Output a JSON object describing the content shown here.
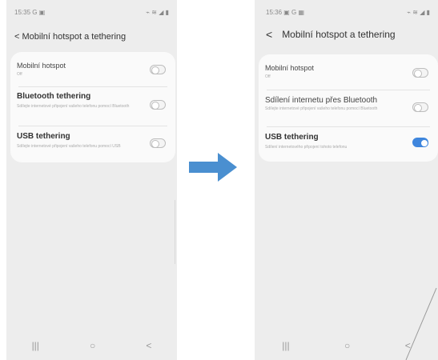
{
  "left": {
    "status_time": "15:35",
    "status_left_icons": "G ▣",
    "status_right_icons": "⌁ ≋ ◢ ▮",
    "title": "< Mobilní hotspot a tethering",
    "rows": [
      {
        "title": "Mobilní hotspot",
        "subtitle": "Off",
        "toggle": "off"
      },
      {
        "title": "Bluetooth tethering",
        "subtitle": "Sdílejte internetové připojení vašeho telefonu pomocí Bluetooth",
        "toggle": "off"
      },
      {
        "title": "USB tethering",
        "subtitle": "Sdílejte internetové připojení vašeho telefonu pomocí USB",
        "toggle": "off"
      }
    ],
    "nav": {
      "recent": "|||",
      "home": "○",
      "back": "<"
    }
  },
  "right": {
    "status_time": "15:36",
    "status_left_icons": "▣ G ▦",
    "status_right_icons": "⌁ ≋ ◢ ▮",
    "back_glyph": "<",
    "title": "Mobilní hotspot a tethering",
    "rows": [
      {
        "title": "Mobilní hotspot",
        "subtitle": "Off",
        "toggle": "off"
      },
      {
        "title": "Sdílení internetu přes Bluetooth",
        "subtitle": "Sdílejte internetové připojení vašeho telefonu pomocí Bluetooth",
        "toggle": "off"
      },
      {
        "title": "USB tethering",
        "subtitle": "Sdílení internetového připojení tohoto telefonu",
        "toggle": "on"
      }
    ],
    "nav": {
      "recent": "|||",
      "home": "○",
      "back": "<"
    }
  },
  "colors": {
    "arrow": "#4a8fd0",
    "toggle_on": "#3f86dd",
    "background": "#ededed",
    "card": "#fafafa"
  }
}
